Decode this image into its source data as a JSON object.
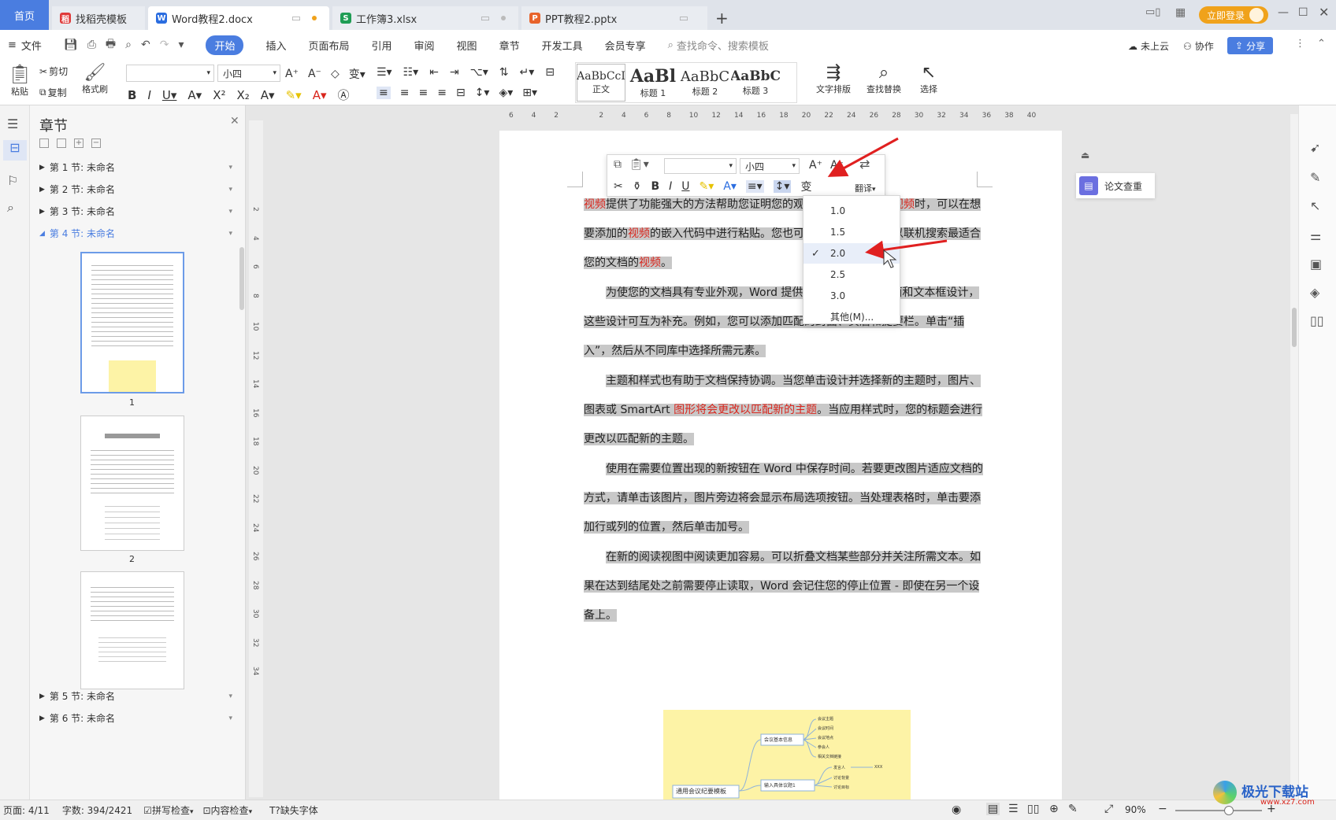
{
  "tabs": {
    "home": "首页",
    "t1": "找稻壳模板",
    "t2": "Word教程2.docx",
    "t3": "工作簿3.xlsx",
    "t4": "PPT教程2.pptx",
    "new": "+",
    "login": "立即登录"
  },
  "menu": {
    "file": "文件",
    "start": "开始",
    "insert": "插入",
    "layout": "页面布局",
    "ref": "引用",
    "review": "审阅",
    "view": "视图",
    "chapter": "章节",
    "dev": "开发工具",
    "member": "会员专享",
    "search": "查找命令、搜索模板",
    "cloud": "未上云",
    "collab": "协作",
    "share": "分享"
  },
  "ribbon": {
    "paste": "粘贴",
    "cut": "剪切",
    "copy": "复制",
    "painter": "格式刷",
    "font_name": "",
    "font_size": "小四",
    "styles": [
      {
        "sample": "AaBbCcI",
        "name": "正文"
      },
      {
        "sample": "AaBl",
        "name": "标题 1"
      },
      {
        "sample": "AaBbC",
        "name": "标题 2"
      },
      {
        "sample": "AaBbC",
        "name": "标题 3"
      }
    ],
    "text_layout": "文字排版",
    "find_replace": "查找替换",
    "select": "选择"
  },
  "nav": {
    "title": "章节",
    "sections": [
      "第 1 节: 未命名",
      "第 2 节: 未命名",
      "第 3 节: 未命名",
      "第 4 节: 未命名",
      "第 5 节: 未命名",
      "第 6 节: 未命名"
    ],
    "page_nums": [
      "1",
      "2"
    ]
  },
  "ruler": [
    "6",
    "4",
    "2",
    "",
    "2",
    "4",
    "6",
    "8",
    "10",
    "12",
    "14",
    "16",
    "18",
    "20",
    "22",
    "24",
    "26",
    "28",
    "30",
    "32",
    "34",
    "36",
    "38",
    "40"
  ],
  "vruler": [
    "2",
    "4",
    "6",
    "8",
    "10",
    "12",
    "14",
    "16",
    "18",
    "20",
    "22",
    "24",
    "26",
    "28",
    "30",
    "32",
    "34"
  ],
  "popup": {
    "font_size": "小四",
    "translate": "翻译"
  },
  "spacing": {
    "options": [
      "1.0",
      "1.5",
      "2.0",
      "2.5",
      "3.0",
      "其他(M)..."
    ],
    "selected": "2.0"
  },
  "paper_check": "论文查重",
  "doc": {
    "p1": [
      "视频",
      "提供了功能强大的方法帮助您证明您的观点。当您单击联机",
      "视频",
      "时，可以在想要添加的",
      "视频",
      "的嵌入代码中进行粘贴。您也可以键入一个关键字以联机搜索最适合您的文档的",
      "视频",
      "。"
    ],
    "p2": "为使您的文档具有专业外观，Word 提供了页眉、页脚、封面和文本框设计，这些设计可互为补充。例如，您可以添加匹配的封面、页眉和提要栏。单击“插入”，然后从不同库中选择所需元素。",
    "p3a": "主题和样式也有助于文档保持协调。当您单击设计并选择新的主题时，图片、图表或 SmartArt ",
    "p3b": "图形将会更改以匹配新的主题",
    "p3c": "。当应用样式时，您的标题会进行更改以匹配新的主题。",
    "p4": "使用在需要位置出现的新按钮在 Word 中保存时间。若要更改图片适应文档的方式，请单击该图片，图片旁边将会显示布局选项按钮。当处理表格时，单击要添加行或列的位置，然后单击加号。",
    "p5": "在新的阅读视图中阅读更加容易。可以折叠文档某些部分并关注所需文本。如果在达到结尾处之前需要停止读取，Word 会记住您的停止位置 - 即使在另一个设备上。",
    "mindmap": {
      "root": "通用会议纪要模板",
      "b1": "会议基本信息",
      "b2": "输入具体议题1",
      "leaves1": [
        "会议主题",
        "会议时间",
        "会议地点",
        "参会人",
        "相关文档链接"
      ],
      "leaves2": [
        "发言人",
        "讨论背景",
        "讨论目标"
      ],
      "xxx": "XXX"
    }
  },
  "status": {
    "page": "页面: 4/11",
    "words": "字数: 394/2421",
    "spell": "拼写检查",
    "content": "内容检查",
    "font": "缺失字体",
    "zoom": "90%"
  },
  "watermark": "极光下载站",
  "watermark_url": "www.xz7.com",
  "colors": {
    "accent": "#4a7de0",
    "red": "#d9251c",
    "highlight": "#c8c8c8",
    "login": "#f0a21b"
  }
}
